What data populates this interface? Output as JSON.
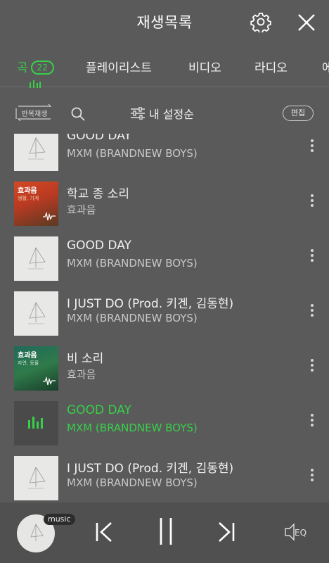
{
  "header": {
    "title": "재생목록",
    "settings_icon": "gear-icon",
    "close_icon": "close-icon"
  },
  "tabs": [
    {
      "label": "곡",
      "badge": "22",
      "active": true
    },
    {
      "label": "플레이리스트"
    },
    {
      "label": "비디오"
    },
    {
      "label": "라디오"
    },
    {
      "label": "에"
    }
  ],
  "toolbar": {
    "repeat_label": "반복재생",
    "sort_label": "내 설정순",
    "edit_label": "편집"
  },
  "songs": [
    {
      "title": "GOOD DAY",
      "artist": "MXM (BRANDNEW BOYS)"
    },
    {
      "title": "학교 종 소리",
      "artist": "효과음",
      "thumb_title": "효과음",
      "thumb_sub": "생활, 기계"
    },
    {
      "title": "GOOD DAY",
      "artist": "MXM (BRANDNEW BOYS)"
    },
    {
      "title": "I JUST DO (Prod. 키겐, 김동현)",
      "artist": "MXM (BRANDNEW BOYS)"
    },
    {
      "title": "비 소리",
      "artist": "효과음",
      "thumb_title": "효과음",
      "thumb_sub": "자연, 동물"
    },
    {
      "title": "GOOD DAY",
      "artist": "MXM (BRANDNEW BOYS)",
      "now_playing": true
    },
    {
      "title": "I JUST DO (Prod. 키겐, 김동현)",
      "artist": "MXM (BRANDNEW BOYS)"
    }
  ],
  "player": {
    "badge": "music",
    "eq_label": "EQ"
  },
  "colors": {
    "background": "#5a5a5a",
    "accent": "#37d04a"
  }
}
